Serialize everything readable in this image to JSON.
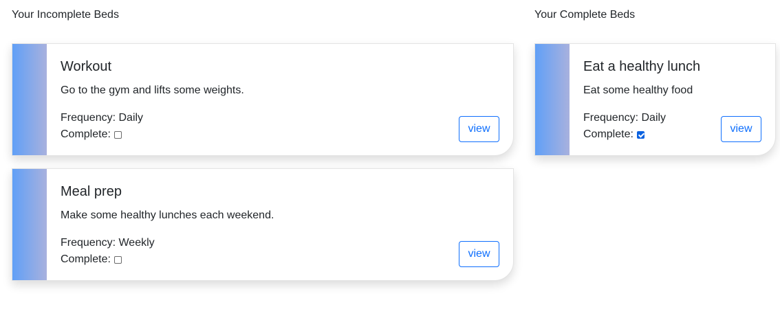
{
  "incomplete": {
    "title": "Your Incomplete Beds",
    "beds": [
      {
        "name": "Workout",
        "description": "Go to the gym and lifts some weights.",
        "frequency": "Frequency: Daily",
        "complete_label": "Complete:",
        "complete": false,
        "view_label": "view"
      },
      {
        "name": "Meal prep",
        "description": "Make some healthy lunches each weekend.",
        "frequency": "Frequency: Weekly",
        "complete_label": "Complete:",
        "complete": false,
        "view_label": "view"
      }
    ]
  },
  "complete": {
    "title": "Your Complete Beds",
    "beds": [
      {
        "name": "Eat a healthy lunch",
        "description": "Eat some healthy food",
        "frequency": "Frequency: Daily",
        "complete_label": "Complete:",
        "complete": true,
        "view_label": "view"
      }
    ]
  },
  "colors": {
    "accent": "#0d6efd",
    "stripe_start": "#5f9ff7",
    "stripe_end": "#a8b1de"
  }
}
